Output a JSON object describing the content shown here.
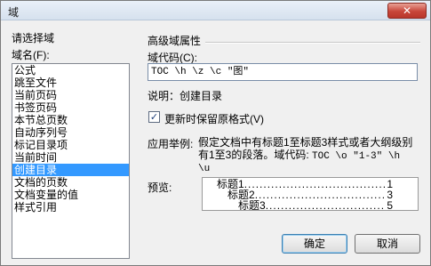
{
  "window": {
    "title": "域",
    "close_glyph": "✕"
  },
  "left": {
    "section_label": "请选择域",
    "field_names_label": "域名(F):",
    "items": [
      {
        "label": "公式",
        "selected": false
      },
      {
        "label": "跳至文件",
        "selected": false
      },
      {
        "label": "当前页码",
        "selected": false
      },
      {
        "label": "书签页码",
        "selected": false
      },
      {
        "label": "本节总页数",
        "selected": false
      },
      {
        "label": "自动序列号",
        "selected": false
      },
      {
        "label": "标记目录项",
        "selected": false
      },
      {
        "label": "当前时间",
        "selected": false
      },
      {
        "label": "创建目录",
        "selected": true
      },
      {
        "label": "文档的页数",
        "selected": false
      },
      {
        "label": "文档变量的值",
        "selected": false
      },
      {
        "label": "样式引用",
        "selected": false
      }
    ]
  },
  "right": {
    "section_label": "高级域属性",
    "field_code_label": "域代码(C):",
    "field_code_value": "TOC \\h \\z \\c \"图\"",
    "description": "说明：创建目录",
    "preserve_format_label": "更新时保留原格式(V)",
    "preserve_format_checked": true,
    "check_glyph": "✓",
    "example_label": "应用举例:",
    "example_line1": "假定文档中有标题1至标题3样式或者大纲级别",
    "example_line2": "有1至3的段落。域代码: ",
    "example_code1": "TOC \\o \"1-3\" \\h",
    "example_code2": "\\u",
    "preview_label": "预览:",
    "preview": [
      {
        "title": "标题1",
        "page": "1"
      },
      {
        "title": "标题2",
        "page": "3"
      },
      {
        "title": "标题3",
        "page": "5"
      }
    ],
    "dots": "................................................"
  },
  "buttons": {
    "ok": "确定",
    "cancel": "取消"
  }
}
